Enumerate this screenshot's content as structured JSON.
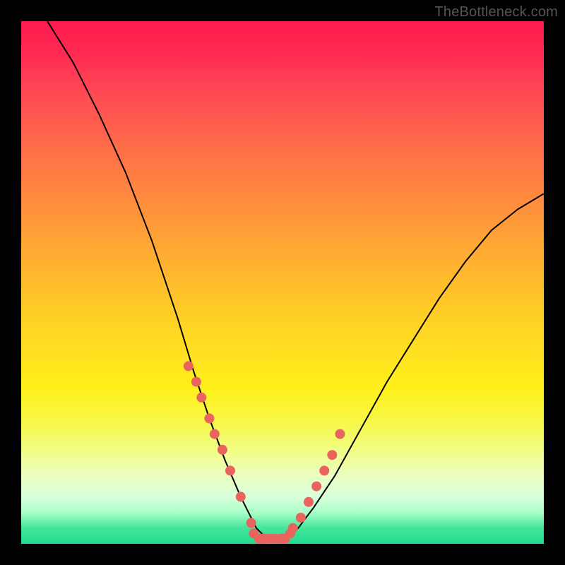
{
  "watermark": "TheBottleneck.com",
  "chart_data": {
    "type": "line",
    "title": "",
    "xlabel": "",
    "ylabel": "",
    "xlim": [
      0,
      100
    ],
    "ylim": [
      0,
      100
    ],
    "curve": {
      "comment": "V-shaped bottleneck percentage curve; y=0 is optimal (green), y=100 is worst (red). Minimum is around x≈47.",
      "x": [
        5,
        10,
        15,
        20,
        25,
        30,
        33,
        36,
        39,
        42,
        45,
        47,
        50,
        53,
        56,
        60,
        65,
        70,
        75,
        80,
        85,
        90,
        95,
        100
      ],
      "y": [
        100,
        92,
        82,
        71,
        58,
        43,
        33,
        24,
        16,
        9,
        3,
        1,
        1,
        3,
        7,
        13,
        22,
        31,
        39,
        47,
        54,
        60,
        64,
        67
      ]
    },
    "series": [
      {
        "name": "left-cluster",
        "comment": "salmon data points on the descending (left) branch near the bottom",
        "x": [
          32,
          33.5,
          34.5,
          36,
          37,
          38.5,
          40,
          42,
          44,
          46
        ],
        "y": [
          34,
          31,
          28,
          24,
          21,
          18,
          14,
          9,
          4,
          1
        ]
      },
      {
        "name": "right-cluster",
        "comment": "salmon data points on the ascending (right) branch near the bottom",
        "x": [
          50,
          52,
          53.5,
          55,
          56.5,
          58,
          59.5,
          61
        ],
        "y": [
          1,
          3,
          5,
          8,
          11,
          14,
          17,
          21
        ]
      },
      {
        "name": "bottom-run",
        "comment": "dense salmon points along the flat minimum",
        "x": [
          44.5,
          45.5,
          46.5,
          47.5,
          48.5,
          49.5,
          50.5,
          51.5
        ],
        "y": [
          2,
          1,
          1,
          1,
          1,
          1,
          1,
          2
        ]
      }
    ],
    "colors": {
      "curve": "#000000",
      "dots": "#e9645f",
      "gradient_top": "#ff1a4d",
      "gradient_bottom": "#1fdc8f",
      "frame": "#000000"
    }
  }
}
